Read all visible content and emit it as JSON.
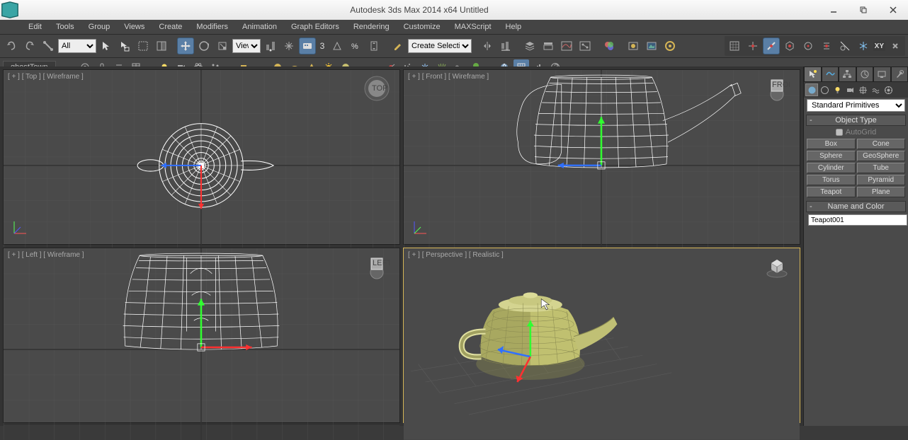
{
  "app": {
    "title": "Autodesk 3ds Max  2014 x64      Untitled"
  },
  "menu": {
    "items": [
      "Edit",
      "Tools",
      "Group",
      "Views",
      "Create",
      "Modifiers",
      "Animation",
      "Graph Editors",
      "Rendering",
      "Customize",
      "MAXScript",
      "Help"
    ]
  },
  "toolbar": {
    "filter_all": "All",
    "ref_view": "View",
    "snap_value": "3",
    "sel_set_placeholder": "Create Selection Se"
  },
  "secondbar": {
    "ghost": "ghostTown"
  },
  "viewports": {
    "top": "[ + ] [ Top ] [ Wireframe ]",
    "front": "[ + ] [ Front ] [ Wireframe ]",
    "left": "[ + ] [ Left ] [ Wireframe ]",
    "persp": "[ + ] [ Perspective ] [ Realistic ]"
  },
  "cmdpanel": {
    "dropdown": "Standard Primitives",
    "rollout1": "Object Type",
    "autogrid_label": "AutoGrid",
    "primitives": [
      "Box",
      "Cone",
      "Sphere",
      "GeoSphere",
      "Cylinder",
      "Tube",
      "Torus",
      "Pyramid",
      "Teapot",
      "Plane"
    ],
    "rollout2": "Name and Color",
    "object_name": "Teapot001"
  }
}
